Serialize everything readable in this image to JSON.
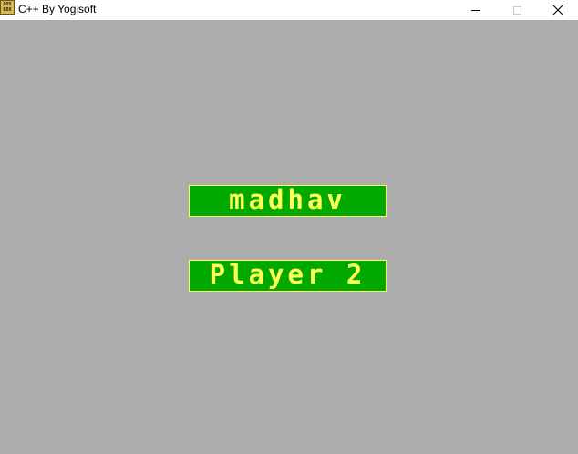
{
  "window": {
    "title": "C++ By Yogisoft",
    "icon_lines": [
      "DOS",
      "BOX"
    ],
    "controls": {
      "minimize": "minimize-icon",
      "maximize": "maximize-icon",
      "close": "close-icon"
    }
  },
  "screen": {
    "background": "#adadad",
    "players": [
      {
        "name": "madhav"
      },
      {
        "name": "Player 2"
      }
    ],
    "box_color": "#00a800",
    "text_color": "#fefe54"
  }
}
